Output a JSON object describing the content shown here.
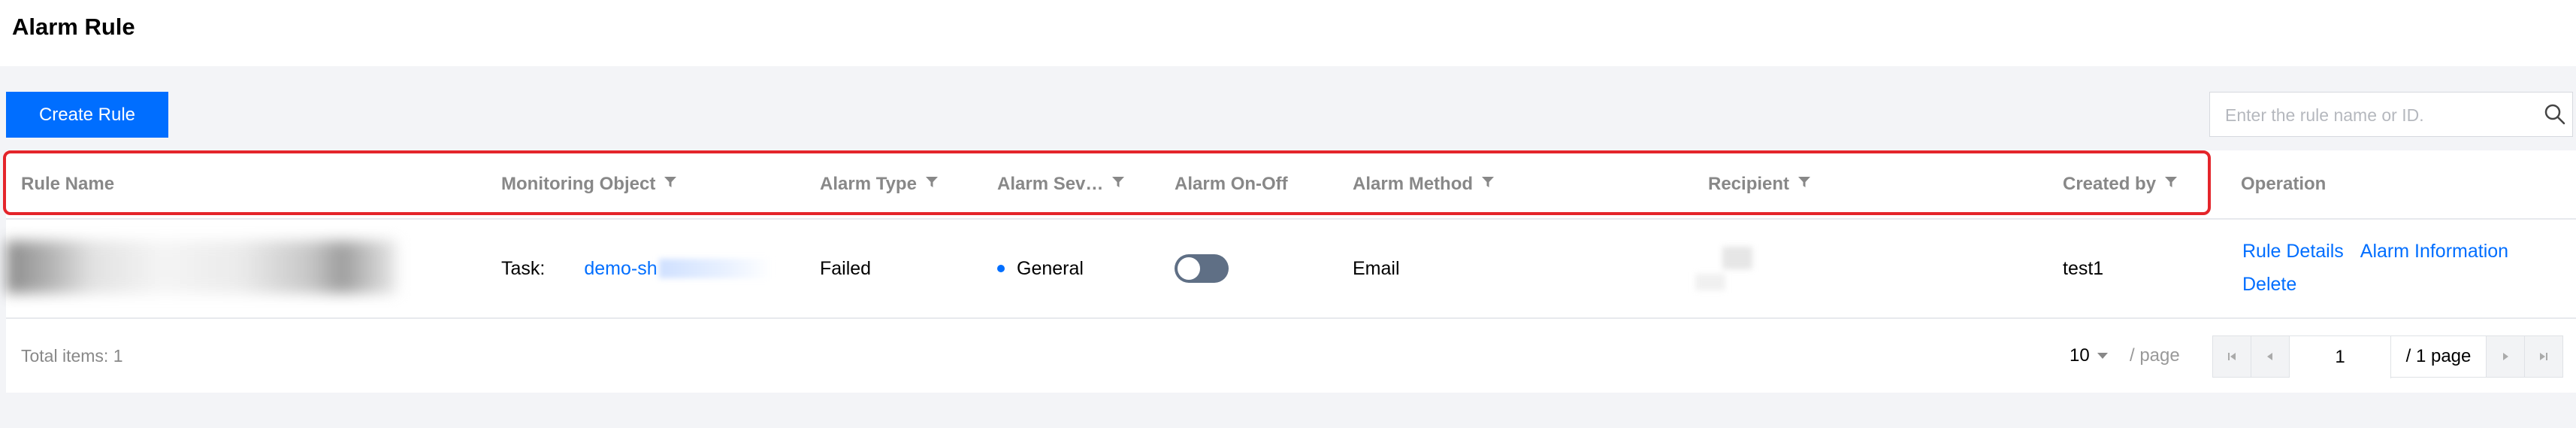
{
  "page": {
    "title": "Alarm Rule"
  },
  "toolbar": {
    "create_label": "Create Rule",
    "search_placeholder": "Enter the rule name or ID."
  },
  "table": {
    "columns": [
      {
        "label": "Rule Name",
        "filter": false
      },
      {
        "label": "Monitoring Object",
        "filter": true
      },
      {
        "label": "Alarm Type",
        "filter": true
      },
      {
        "label": "Alarm Sev…",
        "filter": true
      },
      {
        "label": "Alarm On-Off",
        "filter": false
      },
      {
        "label": "Alarm Method",
        "filter": true
      },
      {
        "label": "Recipient",
        "filter": true
      },
      {
        "label": "Created by",
        "filter": true
      },
      {
        "label": "Operation",
        "filter": false
      }
    ],
    "rows": [
      {
        "monitoring_prefix": "Task:",
        "monitoring_link": "demo-sh",
        "alarm_type": "Failed",
        "severity": "General",
        "severity_color": "#006eff",
        "switch_on": false,
        "method": "Email",
        "created_by": "test1",
        "actions": [
          "Rule Details",
          "Alarm Information",
          "Delete"
        ]
      }
    ]
  },
  "footer": {
    "total_text": "Total items:  1",
    "page_size": "10",
    "per_page_label": "/ page",
    "current_page": "1",
    "total_pages_label": "/ 1 page"
  },
  "colors": {
    "primary": "#006eff",
    "highlight": "#e4252b",
    "toggle_off": "#5f6f85"
  }
}
